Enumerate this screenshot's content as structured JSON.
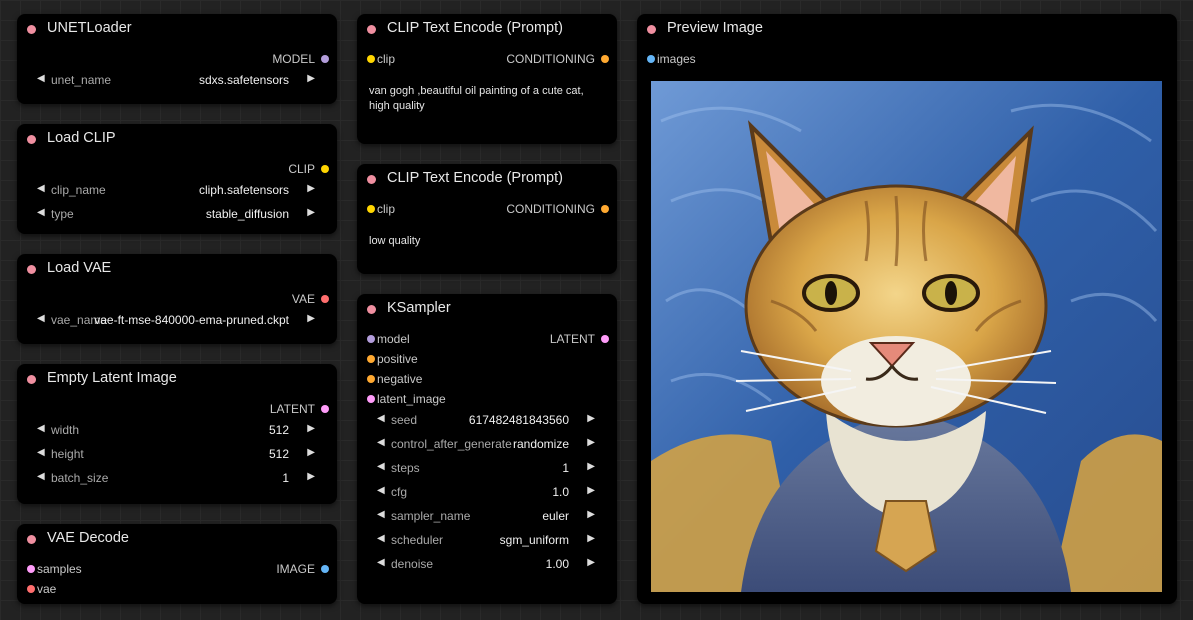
{
  "nodes": {
    "unet_loader": {
      "title": "UNETLoader",
      "outputs": [
        {
          "label": "MODEL",
          "color": "#b39ddb"
        }
      ],
      "widgets": [
        {
          "name": "unet_name",
          "value": "sdxs.safetensors"
        }
      ]
    },
    "load_clip": {
      "title": "Load CLIP",
      "outputs": [
        {
          "label": "CLIP",
          "color": "#ffd500"
        }
      ],
      "widgets": [
        {
          "name": "clip_name",
          "value": "cliph.safetensors"
        },
        {
          "name": "type",
          "value": "stable_diffusion"
        }
      ]
    },
    "load_vae": {
      "title": "Load VAE",
      "outputs": [
        {
          "label": "VAE",
          "color": "#ff6e6e"
        }
      ],
      "widgets": [
        {
          "name": "vae_name",
          "value": "vae-ft-mse-840000-ema-pruned.ckpt"
        }
      ]
    },
    "empty_latent": {
      "title": "Empty Latent Image",
      "outputs": [
        {
          "label": "LATENT",
          "color": "#ff9cf9"
        }
      ],
      "widgets": [
        {
          "name": "width",
          "value": "512"
        },
        {
          "name": "height",
          "value": "512"
        },
        {
          "name": "batch_size",
          "value": "1"
        }
      ]
    },
    "vae_decode": {
      "title": "VAE Decode",
      "inputs": [
        {
          "label": "samples",
          "color": "#ff9cf9"
        },
        {
          "label": "vae",
          "color": "#ff6e6e"
        }
      ],
      "outputs": [
        {
          "label": "IMAGE",
          "color": "#64b5f6"
        }
      ]
    },
    "clip_text_pos": {
      "title": "CLIP Text Encode (Prompt)",
      "inputs": [
        {
          "label": "clip",
          "color": "#ffd500"
        }
      ],
      "outputs": [
        {
          "label": "CONDITIONING",
          "color": "#ffa931"
        }
      ],
      "text": "van gogh ,beautiful oil painting of a cute cat,\nhigh quality"
    },
    "clip_text_neg": {
      "title": "CLIP Text Encode (Prompt)",
      "inputs": [
        {
          "label": "clip",
          "color": "#ffd500"
        }
      ],
      "outputs": [
        {
          "label": "CONDITIONING",
          "color": "#ffa931"
        }
      ],
      "text": "low quality"
    },
    "ksampler": {
      "title": "KSampler",
      "inputs": [
        {
          "label": "model",
          "color": "#b39ddb"
        },
        {
          "label": "positive",
          "color": "#ffa931"
        },
        {
          "label": "negative",
          "color": "#ffa931"
        },
        {
          "label": "latent_image",
          "color": "#ff9cf9"
        }
      ],
      "outputs": [
        {
          "label": "LATENT",
          "color": "#ff9cf9"
        }
      ],
      "widgets": [
        {
          "name": "seed",
          "value": "617482481843560"
        },
        {
          "name": "control_after_generate",
          "value": "randomize"
        },
        {
          "name": "steps",
          "value": "1"
        },
        {
          "name": "cfg",
          "value": "1.0"
        },
        {
          "name": "sampler_name",
          "value": "euler"
        },
        {
          "name": "scheduler",
          "value": "sgm_uniform"
        },
        {
          "name": "denoise",
          "value": "1.00"
        }
      ]
    },
    "preview_image": {
      "title": "Preview Image",
      "inputs": [
        {
          "label": "images",
          "color": "#64b5f6"
        }
      ],
      "image_alt": "cat-painting"
    }
  },
  "arrows": {
    "left": "◀",
    "right": "▶"
  },
  "colors": {
    "title_dot": "#ef8fa0",
    "node_bg": "#000000",
    "canvas_bg": "#222222"
  }
}
